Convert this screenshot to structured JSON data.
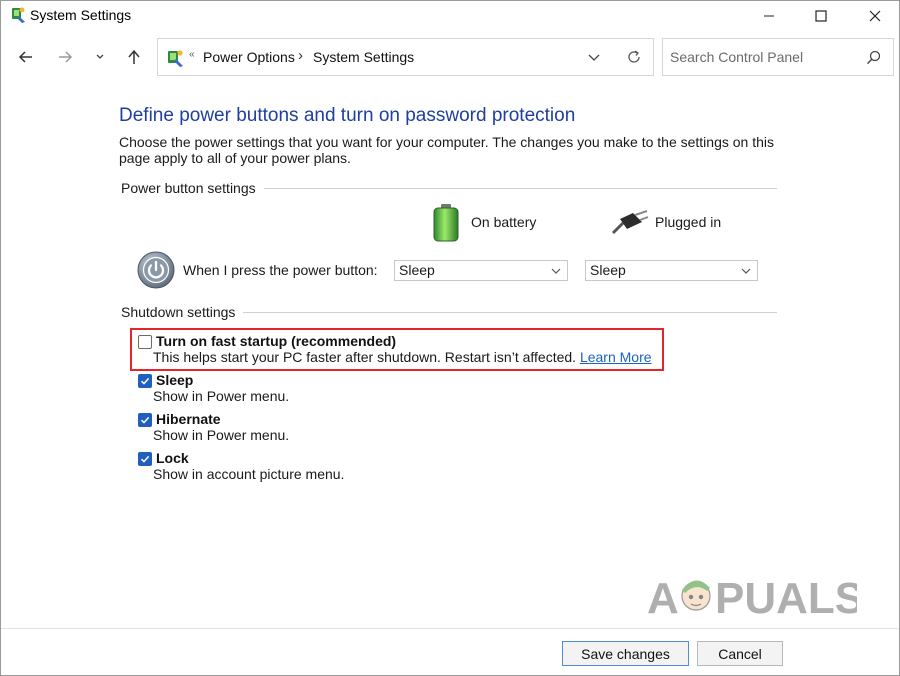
{
  "window": {
    "title": "System Settings",
    "controls": [
      "minimize",
      "maximize",
      "close"
    ]
  },
  "nav": {
    "back": "back-arrow",
    "forward": "forward-arrow",
    "recent": "chevron-down",
    "up": "up-arrow",
    "breadcrumb_overflow": "«",
    "breadcrumb": [
      "Power Options",
      "System Settings"
    ],
    "breadcrumb_separator": "›",
    "search_placeholder": "Search Control Panel"
  },
  "page": {
    "heading": "Define power buttons and turn on password protection",
    "intro": "Choose the power settings that you want for your computer. The changes you make to the settings on this page apply to all of your power plans."
  },
  "power_button_settings": {
    "group_label": "Power button settings",
    "col_battery": "On battery",
    "col_plugged": "Plugged in",
    "row_label": "When I press the power button:",
    "battery_value": "Sleep",
    "plugged_value": "Sleep"
  },
  "shutdown_settings": {
    "group_label": "Shutdown settings",
    "fast_startup": {
      "title": "Turn on fast startup (recommended)",
      "desc": "This helps start your PC faster after shutdown. Restart isn’t affected.",
      "link": "Learn More",
      "checked": false
    },
    "options": [
      {
        "title": "Sleep",
        "desc": "Show in Power menu.",
        "checked": true
      },
      {
        "title": "Hibernate",
        "desc": "Show in Power menu.",
        "checked": true
      },
      {
        "title": "Lock",
        "desc": "Show in account picture menu.",
        "checked": true
      }
    ]
  },
  "watermark": {
    "text_a": "A",
    "text_b": "PUALS"
  },
  "footer": {
    "save": "Save changes",
    "cancel": "Cancel"
  },
  "colors": {
    "heading": "#1f3fa0",
    "checkbox": "#1f5fbf",
    "highlight": "#e2262c",
    "link": "#1a62c6"
  }
}
